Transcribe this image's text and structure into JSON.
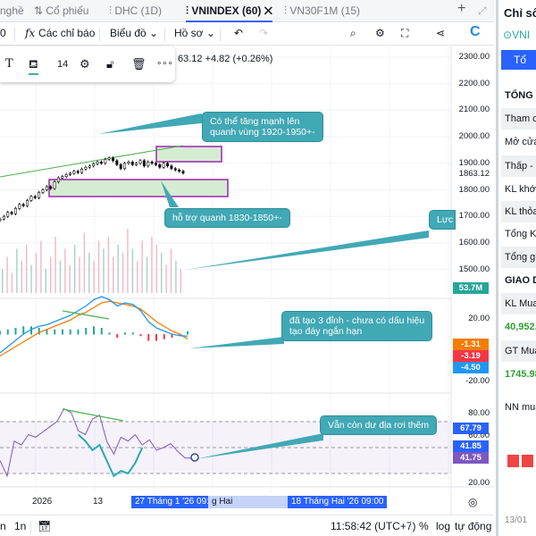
{
  "tabs": [
    {
      "label": "nghề"
    },
    {
      "label": "Cổ phiếu"
    },
    {
      "label": "DHC (1D)"
    },
    {
      "label": "VNINDEX (60)"
    },
    {
      "label": "VN30F1M (15)"
    }
  ],
  "toolbar": {
    "interval": "0",
    "indicators": "Các chỉ báo",
    "chart": "Biểu đồ",
    "profile": "Hồ sơ"
  },
  "drawbar": {
    "font_size": "14"
  },
  "legend": {
    "price_change": "63.12 +4.82 (+0.26%)"
  },
  "price_axis": [
    "2300.00",
    "2200.00",
    "2100.00",
    "2000.00",
    "1900.00",
    "1800.00",
    "1700.00",
    "1600.00",
    "1500.00"
  ],
  "price_tags": {
    "last": "1863.12",
    "volume": "53.7M"
  },
  "macd_axis": [
    "20.00",
    "-20.00"
  ],
  "macd_tags": [
    {
      "text": "-1.31",
      "color": "#f57c00"
    },
    {
      "text": "-3.19",
      "color": "#f23645"
    },
    {
      "text": "-4.50",
      "color": "#2196f3"
    }
  ],
  "rsi_axis": [
    "80.00",
    "60.00",
    "20.00"
  ],
  "rsi_tags": [
    {
      "text": "67.79",
      "color": "#2962ff"
    },
    {
      "text": "41.85",
      "color": "#2962ff"
    },
    {
      "text": "41.75",
      "color": "#7e57c2"
    }
  ],
  "notes": {
    "up": "Có thể tăng mạnh lên\nquanh vùng 1920-1950+-",
    "support": "hỗ trợ quanh 1830-1850+-",
    "volume": "Lực",
    "macd": "đã tạo 3 đỉnh - chưa có dấu hiệu\ntạo đáy ngắn hạn",
    "rsi": "Vẫn còn dư địa rơi thêm"
  },
  "time_axis": {
    "labels": [
      "2026",
      "13",
      "g Hai",
      "9"
    ],
    "sel_start": "27 Tháng 1 '26   09:00",
    "sel_end": "18 Tháng Hai '26   09:00"
  },
  "bottom": {
    "ranges": [
      "n",
      "1n"
    ],
    "clock": "11:58:42 (UTC+7)",
    "percent": "%",
    "log": "log",
    "auto": "tự động"
  },
  "right_panel": {
    "title": "Chỉ số",
    "symbol": "VNI",
    "button": "Tổ",
    "section1": "TỔNG C",
    "rows": [
      "Tham ch",
      "Mở cửa",
      "Thấp - C",
      "KL khớp",
      "KL thỏa",
      "Tổng KL",
      "Tổng gia"
    ],
    "section2": "GIAO D",
    "kl_mua": "KL Mua",
    "kl_mua_val": "40,952,",
    "gt_mua": "GT Mua",
    "gt_mua_val": "1745.98",
    "nn_mua": "NN mua",
    "date": "13/01"
  },
  "chart_data": {
    "type": "line",
    "closes": [
      1690,
      1700,
      1715,
      1710,
      1730,
      1745,
      1740,
      1760,
      1775,
      1770,
      1790,
      1800,
      1812,
      1805,
      1830,
      1845,
      1850,
      1858,
      1862,
      1870,
      1865,
      1878,
      1885,
      1890,
      1898,
      1905,
      1900,
      1915,
      1920,
      1910,
      1895,
      1880,
      1900,
      1905,
      1895,
      1900,
      1910,
      1890,
      1905,
      1900,
      1895,
      1885,
      1900,
      1890,
      1880,
      1875,
      1870,
      1863.12
    ],
    "volume": [
      30,
      45,
      25,
      55,
      40,
      60,
      35,
      50,
      65,
      30,
      45,
      70,
      40,
      55,
      35,
      60,
      45,
      75,
      50,
      40,
      65,
      55,
      70,
      45,
      60,
      50,
      80,
      55,
      40,
      65,
      45,
      70,
      60,
      50,
      35,
      55,
      40,
      30
    ],
    "macd": [
      -12,
      -8,
      -4,
      0,
      3,
      5,
      6,
      8,
      10,
      12,
      15,
      18,
      22,
      24,
      22,
      18,
      20,
      19,
      15,
      8,
      4,
      2,
      0,
      -1,
      -1.31
    ],
    "signal": [
      -14,
      -11,
      -8,
      -5,
      -2,
      1,
      3,
      5,
      7,
      9,
      12,
      14,
      17,
      20,
      21,
      20,
      19,
      18,
      16,
      12,
      8,
      5,
      2,
      0,
      -3.19
    ],
    "rsi": [
      40,
      28,
      55,
      52,
      60,
      58,
      62,
      66,
      70,
      80,
      77,
      63,
      60,
      72,
      75,
      55,
      45,
      58,
      55,
      60,
      52,
      56,
      48,
      50,
      53,
      47,
      42,
      41.75
    ],
    "rsi_ma": [
      null,
      null,
      null,
      null,
      null,
      null,
      null,
      null,
      null,
      null,
      null,
      60,
      55,
      48,
      52,
      40,
      28,
      32,
      30,
      38,
      50,
      null,
      null,
      null,
      null,
      null,
      null,
      null
    ]
  }
}
